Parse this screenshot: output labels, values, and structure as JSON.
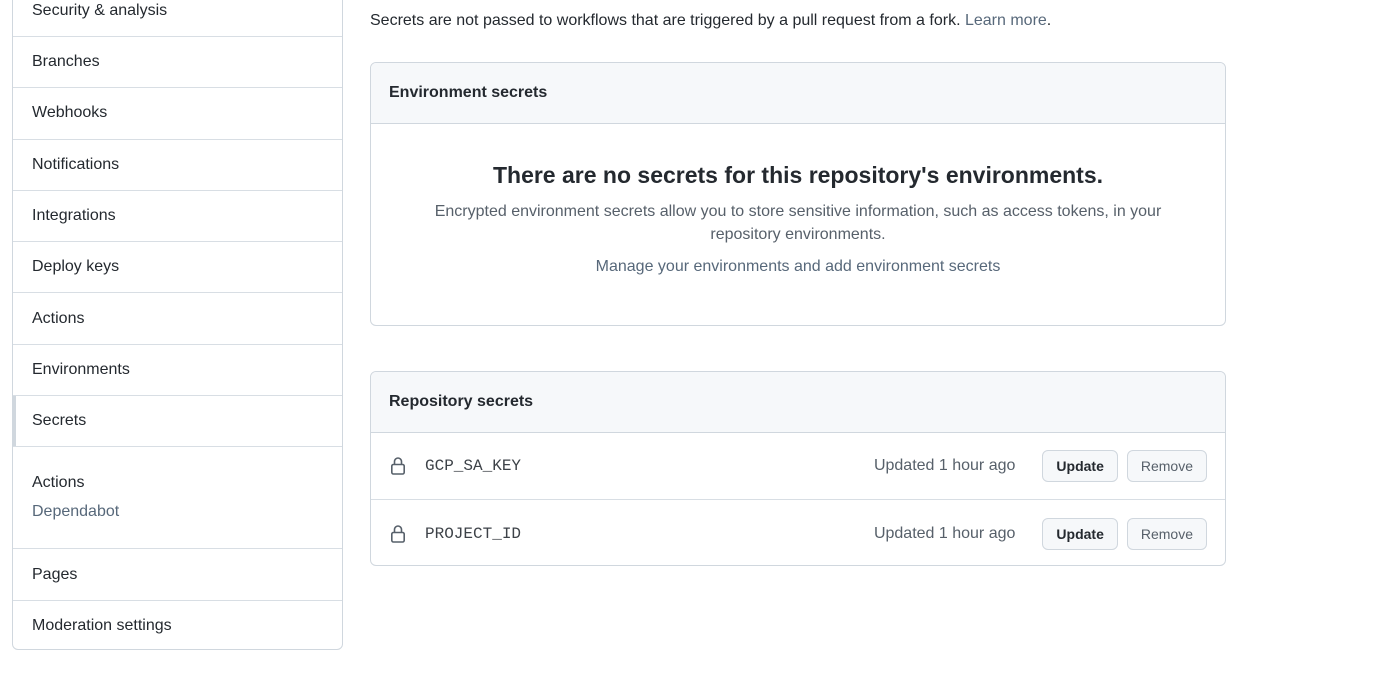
{
  "sidebar": {
    "items": [
      {
        "label": "Security & analysis"
      },
      {
        "label": "Branches"
      },
      {
        "label": "Webhooks"
      },
      {
        "label": "Notifications"
      },
      {
        "label": "Integrations"
      },
      {
        "label": "Deploy keys"
      },
      {
        "label": "Actions"
      },
      {
        "label": "Environments"
      },
      {
        "label": "Secrets",
        "selected": true
      }
    ],
    "secrets_group": {
      "title": "Actions",
      "link": "Dependabot"
    },
    "bottom_items": [
      {
        "label": "Pages"
      },
      {
        "label": "Moderation settings"
      }
    ]
  },
  "notice": {
    "text": "Secrets are not passed to workflows that are triggered by a pull request from a fork.",
    "link": "Learn more",
    "suffix": "."
  },
  "environment_secrets": {
    "header": "Environment secrets",
    "empty_title": "There are no secrets for this repository's environments.",
    "empty_desc": "Encrypted environment secrets allow you to store sensitive information, such as access tokens, in your repository environments.",
    "manage_link": "Manage your environments and add environment secrets"
  },
  "repository_secrets": {
    "header": "Repository secrets",
    "rows": [
      {
        "name": "GCP_SA_KEY",
        "updated": "Updated 1 hour ago",
        "update_label": "Update",
        "remove_label": "Remove"
      },
      {
        "name": "PROJECT_ID",
        "updated": "Updated 1 hour ago",
        "update_label": "Update",
        "remove_label": "Remove"
      }
    ]
  },
  "icons": {
    "lock": "lock-icon"
  }
}
